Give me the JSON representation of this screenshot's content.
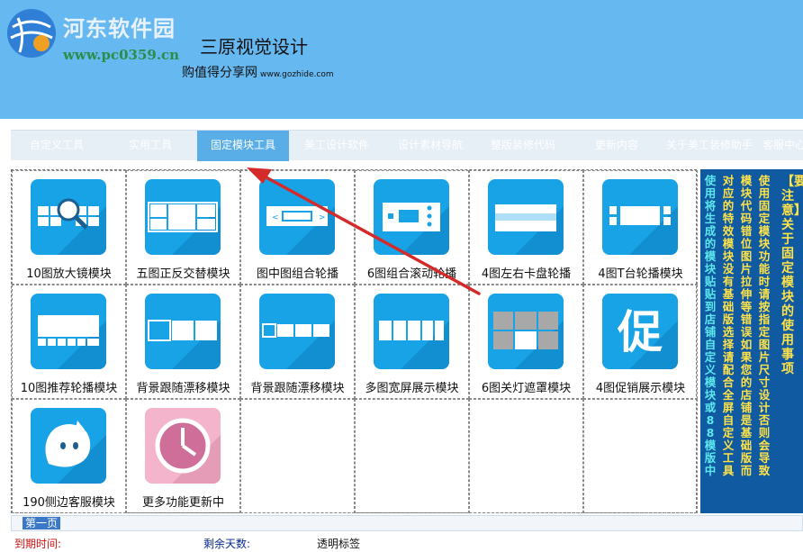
{
  "header": {
    "logo_name": "河东软件园",
    "logo_url": "www.pc0359.cn",
    "app_title": "三原视觉设计",
    "app_subtitle": "购值得分享网",
    "app_subtitle_url": "www.gozhide.com"
  },
  "nav": {
    "items": [
      {
        "label": "自定义工具"
      },
      {
        "label": "实用工具"
      },
      {
        "label": "固定模块工具"
      },
      {
        "label": "美工设计软件"
      },
      {
        "label": "设计素材导航"
      },
      {
        "label": "整版装修代码"
      },
      {
        "label": "更新内容"
      },
      {
        "label": "关于美工装修助手"
      },
      {
        "label": "客服中心"
      }
    ],
    "active_index": 2
  },
  "modules": [
    {
      "label": "10图放大镜模块",
      "icon": "magnifier-strip-icon"
    },
    {
      "label": "五图正反交替模块",
      "icon": "alternating-blocks-icon"
    },
    {
      "label": "图中图组合轮播",
      "icon": "picture-in-picture-carousel-icon"
    },
    {
      "label": "6图组合滚动轮播",
      "icon": "scroll-carousel-icon"
    },
    {
      "label": "4图左右卡盘轮播",
      "icon": "card-carousel-icon"
    },
    {
      "label": "4图T台轮播模块",
      "icon": "runway-carousel-icon"
    },
    {
      "label": "10图推荐轮播模块",
      "icon": "recommend-carousel-icon"
    },
    {
      "label": "背景跟随漂移模块",
      "icon": "background-drift-icon"
    },
    {
      "label": "背景跟随漂移模块",
      "icon": "background-drift-small-icon"
    },
    {
      "label": "多图宽屏展示模块",
      "icon": "widescreen-display-icon"
    },
    {
      "label": "6图关灯遮罩模块",
      "icon": "lights-off-mask-icon"
    },
    {
      "label": "4图促销展示模块",
      "icon": "promotion-icon",
      "glyph": "促"
    },
    {
      "label": "190侧边客服模块",
      "icon": "customer-service-mascot-icon"
    },
    {
      "label": "更多功能更新中",
      "icon": "clock-icon"
    }
  ],
  "notice": {
    "title": "【要注意】关于固定模块的使用事项",
    "columns": [
      "使用固定模块功能时请按指定图片尺寸设计否则会导致",
      "模块代码错位图片拉伸等错误如果您的店铺是基础版而",
      "对应的特效模块没有基础版选择请配合全屏自定义工具",
      "使用 将生成的模块贴贴到店铺自定义模块或88模版中"
    ]
  },
  "pager": {
    "page_label": "第一页"
  },
  "status": {
    "expiry_label": "到期时间:",
    "days_left_label": "剩余天数:",
    "transparent_label": "透明标签"
  },
  "colors": {
    "header_bg": "#66b8f0",
    "tile_blue": "#17a3e6",
    "notice_bg": "#0f5aa0",
    "arrow_red": "#d42a2a",
    "accent_active_tab": "#5aaee8"
  }
}
